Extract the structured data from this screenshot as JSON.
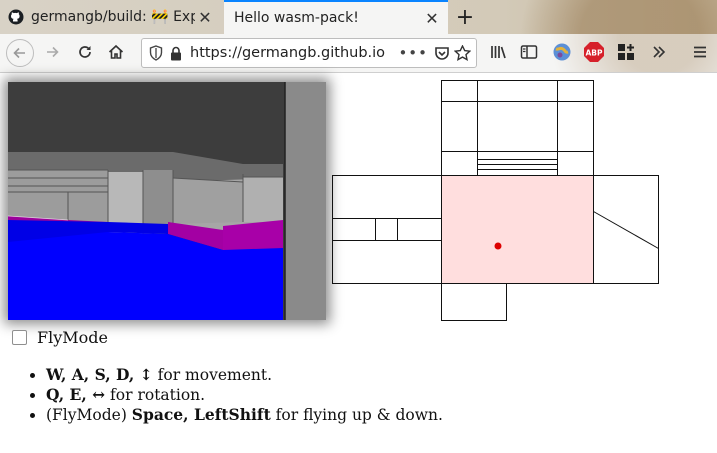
{
  "browser": {
    "tabs": [
      {
        "title": "germangb/build: 🚧 Expe",
        "active": false
      },
      {
        "title": "Hello wasm-pack!",
        "active": true
      }
    ],
    "new_tab_label": "+",
    "url": "https://germangb.github.io",
    "url_more": "•••"
  },
  "page": {
    "flymode_label": "FlyMode",
    "flymode_checked": false,
    "controls": [
      {
        "keys": "W, A, S, D, ↕",
        "text": " for movement."
      },
      {
        "keys": "Q, E, ↔",
        "text": " for rotation."
      },
      {
        "prefix": "(FlyMode) ",
        "keys": "Space, LeftShift",
        "text": " for flying up & down."
      }
    ]
  },
  "colors": {
    "accent": "#0a84ff",
    "floor": "#0000ff",
    "steps": "#a000a0",
    "ceiling": "#404040",
    "wall": "#9a9a9a",
    "current_sector": "#ffdede",
    "player_dot": "#dd0000"
  }
}
